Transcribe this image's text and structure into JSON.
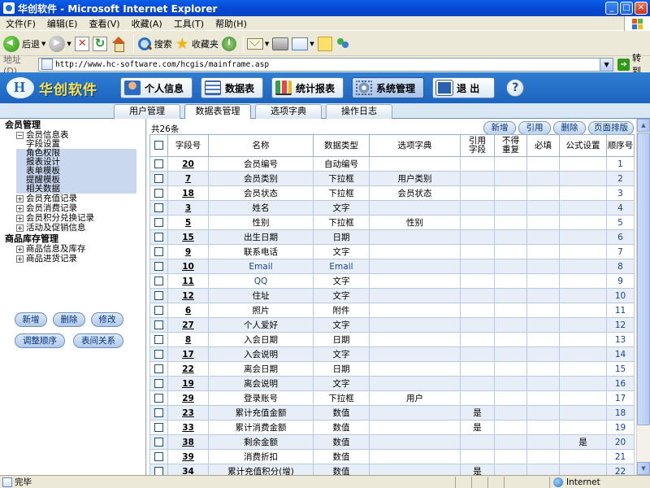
{
  "window": {
    "title": "华创软件 - Microsoft Internet Explorer",
    "buttons": [
      "_",
      "□",
      "✕"
    ]
  },
  "menu": [
    "文件(F)",
    "编辑(E)",
    "查看(V)",
    "收藏(A)",
    "工具(T)",
    "帮助(H)"
  ],
  "toolbar": {
    "back_label": "后退",
    "search_label": "搜索",
    "favorites_label": "收藏夹"
  },
  "address": {
    "label": "地址(D)",
    "url": "http://www.hc-software.com/hcgis/mainframe.asp",
    "go_label": "转到"
  },
  "app": {
    "logo_text": "华创软件",
    "nav": [
      {
        "label": "个人信息",
        "icon": "user-icon"
      },
      {
        "label": "数据表",
        "icon": "table-icon"
      },
      {
        "label": "统计报表",
        "icon": "chart-icon"
      },
      {
        "label": "系统管理",
        "icon": "gear-icon"
      },
      {
        "label": "退 出",
        "icon": "exit-icon"
      }
    ],
    "help_label": "?"
  },
  "tabs": [
    "用户管理",
    "数据表管理",
    "选项字典",
    "操作日志"
  ],
  "tree": {
    "group1": "会员管理",
    "member_info": "会员信息表",
    "member_info_children": [
      "字段设置",
      "角色权限",
      "报表设计",
      "表单模板",
      "提醒模板",
      "相关数据"
    ],
    "nodes1": [
      "会员充值记录",
      "会员消费记录",
      "会员积分兑换记录",
      "活动及促销信息"
    ],
    "group2": "商品库存管理",
    "nodes2": [
      "商品信息及库存",
      "商品进货记录"
    ],
    "expanded_symbol": "−",
    "collapsed_symbol": "+"
  },
  "left_buttons": {
    "add": "新增",
    "delete": "删除",
    "edit": "修改",
    "reorder": "调整顺序",
    "relation": "表间关系"
  },
  "main": {
    "count_text": "共26条",
    "actions": {
      "add": "新增",
      "cite": "引用",
      "delete": "删除",
      "page_sort": "页面排版"
    }
  },
  "table": {
    "headers": [
      "字段号",
      "名称",
      "数据类型",
      "选项字典",
      "引用字段",
      "不得重复",
      "必填",
      "公式设置",
      "顺序号"
    ],
    "rows": [
      {
        "id": "20",
        "name": "会员编号",
        "type": "自动编号",
        "dict": "",
        "cite": "",
        "unique": "",
        "required": "",
        "formula": "",
        "seq": "1"
      },
      {
        "id": "7",
        "name": "会员类别",
        "type": "下拉框",
        "dict": "用户类别",
        "cite": "",
        "unique": "",
        "required": "",
        "formula": "",
        "seq": "2"
      },
      {
        "id": "18",
        "name": "会员状态",
        "type": "下拉框",
        "dict": "会员状态",
        "cite": "",
        "unique": "",
        "required": "",
        "formula": "",
        "seq": "3"
      },
      {
        "id": "3",
        "name": "姓名",
        "type": "文字",
        "dict": "",
        "cite": "",
        "unique": "",
        "required": "",
        "formula": "",
        "seq": "4"
      },
      {
        "id": "5",
        "name": "性别",
        "type": "下拉框",
        "dict": "性别",
        "cite": "",
        "unique": "",
        "required": "",
        "formula": "",
        "seq": "5"
      },
      {
        "id": "15",
        "name": "出生日期",
        "type": "日期",
        "dict": "",
        "cite": "",
        "unique": "",
        "required": "",
        "formula": "",
        "seq": "6"
      },
      {
        "id": "9",
        "name": "联系电话",
        "type": "文字",
        "dict": "",
        "cite": "",
        "unique": "",
        "required": "",
        "formula": "",
        "seq": "7"
      },
      {
        "id": "10",
        "name": "Email",
        "type": "Email",
        "dict": "",
        "cite": "",
        "unique": "",
        "required": "",
        "formula": "",
        "seq": "8"
      },
      {
        "id": "11",
        "name": "QQ",
        "type": "文字",
        "dict": "",
        "cite": "",
        "unique": "",
        "required": "",
        "formula": "",
        "seq": "9"
      },
      {
        "id": "12",
        "name": "住址",
        "type": "文字",
        "dict": "",
        "cite": "",
        "unique": "",
        "required": "",
        "formula": "",
        "seq": "10"
      },
      {
        "id": "6",
        "name": "照片",
        "type": "附件",
        "dict": "",
        "cite": "",
        "unique": "",
        "required": "",
        "formula": "",
        "seq": "11"
      },
      {
        "id": "27",
        "name": "个人爱好",
        "type": "文字",
        "dict": "",
        "cite": "",
        "unique": "",
        "required": "",
        "formula": "",
        "seq": "12"
      },
      {
        "id": "8",
        "name": "入会日期",
        "type": "日期",
        "dict": "",
        "cite": "",
        "unique": "",
        "required": "",
        "formula": "",
        "seq": "13"
      },
      {
        "id": "17",
        "name": "入会说明",
        "type": "文字",
        "dict": "",
        "cite": "",
        "unique": "",
        "required": "",
        "formula": "",
        "seq": "14"
      },
      {
        "id": "22",
        "name": "离会日期",
        "type": "日期",
        "dict": "",
        "cite": "",
        "unique": "",
        "required": "",
        "formula": "",
        "seq": "15"
      },
      {
        "id": "19",
        "name": "离会说明",
        "type": "文字",
        "dict": "",
        "cite": "",
        "unique": "",
        "required": "",
        "formula": "",
        "seq": "16"
      },
      {
        "id": "29",
        "name": "登录账号",
        "type": "下拉框",
        "dict": "用户",
        "cite": "",
        "unique": "",
        "required": "",
        "formula": "",
        "seq": "17"
      },
      {
        "id": "23",
        "name": "累计充值金额",
        "type": "数值",
        "dict": "",
        "cite": "是",
        "unique": "",
        "required": "",
        "formula": "",
        "seq": "18"
      },
      {
        "id": "33",
        "name": "累计消费金额",
        "type": "数值",
        "dict": "",
        "cite": "是",
        "unique": "",
        "required": "",
        "formula": "",
        "seq": "19"
      },
      {
        "id": "38",
        "name": "剩余金额",
        "type": "数值",
        "dict": "",
        "cite": "",
        "unique": "",
        "required": "",
        "formula": "是",
        "seq": "20"
      },
      {
        "id": "39",
        "name": "消费折扣",
        "type": "数值",
        "dict": "",
        "cite": "",
        "unique": "",
        "required": "",
        "formula": "",
        "seq": "21"
      },
      {
        "id": "34",
        "name": "累计充值积分(增)",
        "type": "数值",
        "dict": "",
        "cite": "是",
        "unique": "",
        "required": "",
        "formula": "",
        "seq": "22"
      }
    ]
  },
  "status": {
    "text": "完毕",
    "zone": "Internet"
  }
}
